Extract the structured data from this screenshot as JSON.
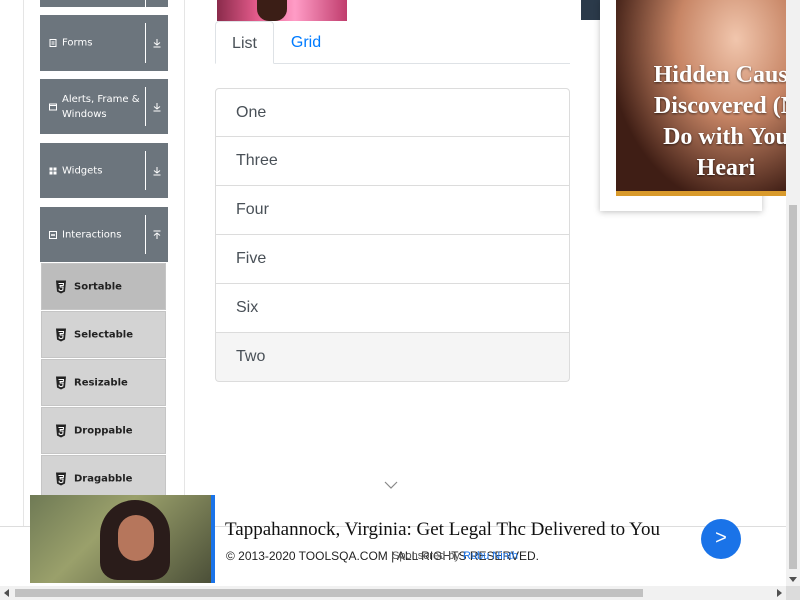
{
  "sidebar": {
    "groups": [
      {
        "label": "",
        "icon": "",
        "arrow": "download-arrow-icon"
      },
      {
        "label": "Forms",
        "icon": "form-icon",
        "arrow": "download-arrow-icon"
      },
      {
        "label": "Alerts, Frame & Windows",
        "icon": "window-icon",
        "arrow": "download-arrow-icon"
      },
      {
        "label": "Widgets",
        "icon": "grid-icon",
        "arrow": "download-arrow-icon"
      },
      {
        "label": "Interactions",
        "icon": "interaction-icon",
        "arrow": "upload-arrow-icon"
      }
    ],
    "items": [
      {
        "label": "Sortable",
        "active": true
      },
      {
        "label": "Selectable",
        "active": false
      },
      {
        "label": "Resizable",
        "active": false
      },
      {
        "label": "Droppable",
        "active": false
      },
      {
        "label": "Dragabble",
        "active": false
      }
    ]
  },
  "tabs": [
    {
      "label": "List",
      "active": true
    },
    {
      "label": "Grid",
      "active": false
    }
  ],
  "list": [
    "One",
    "Three",
    "Four",
    "Five",
    "Six",
    "Two"
  ],
  "ad_right": {
    "headline": "Hidden Cause\nDiscovered (N\nDo with You\nHeari"
  },
  "bottom_ad": {
    "title": "Tappahannock, Virginia: Get Legal Thc Delivered to You",
    "button": ">"
  },
  "footer": {
    "copyright": "© 2013-2020 TOOLSQA.COM | ALL RIGHTS RESERVED.",
    "sponsored_prefix": "Sponsored by",
    "sponsored_link": "Rubu Ninth"
  }
}
